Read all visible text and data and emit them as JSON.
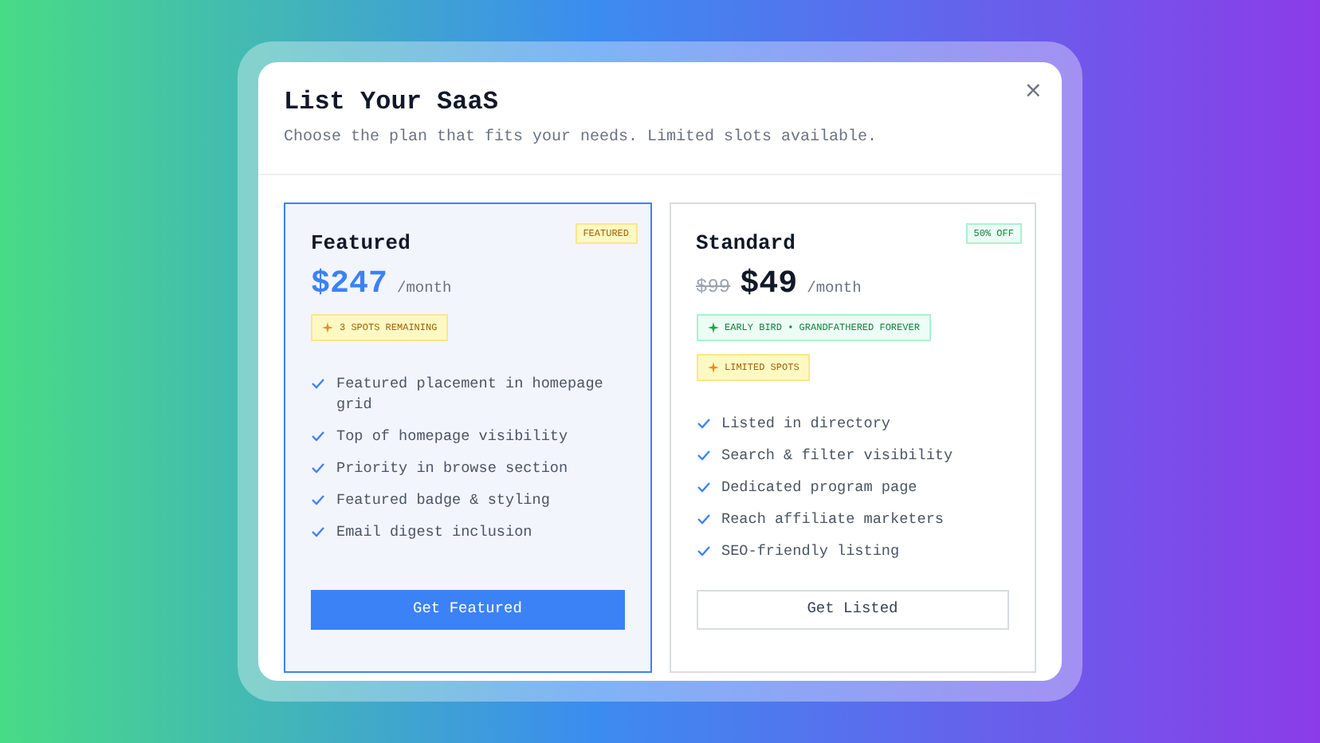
{
  "dialog": {
    "title": "List Your SaaS",
    "subtitle": "Choose the plan that fits your needs. Limited slots available.",
    "close": "×"
  },
  "plans": [
    {
      "name": "Featured",
      "highlighted": true,
      "corner_badge": {
        "text": "FEATURED",
        "kind": "warning"
      },
      "price": "$247",
      "period": "/month",
      "badges": [
        {
          "text": "3 SPOTS REMAINING",
          "kind": "warning"
        }
      ],
      "features": [
        "Featured placement in homepage grid",
        "Top of homepage visibility",
        "Priority in browse section",
        "Featured badge & styling",
        "Email digest inclusion"
      ],
      "button": {
        "label": "Get Featured",
        "kind": "primary"
      }
    },
    {
      "name": "Standard",
      "highlighted": false,
      "corner_badge": {
        "text": "50% OFF",
        "kind": "success"
      },
      "old_price": "$99",
      "price": "$49",
      "period": "/month",
      "badges": [
        {
          "text": "EARLY BIRD • GRANDFATHERED FOREVER",
          "kind": "success"
        },
        {
          "text": "LIMITED SPOTS",
          "kind": "warning"
        }
      ],
      "features": [
        "Listed in directory",
        "Search & filter visibility",
        "Dedicated program page",
        "Reach affiliate marketers",
        "SEO-friendly listing"
      ],
      "button": {
        "label": "Get Listed",
        "kind": "outline"
      }
    }
  ]
}
